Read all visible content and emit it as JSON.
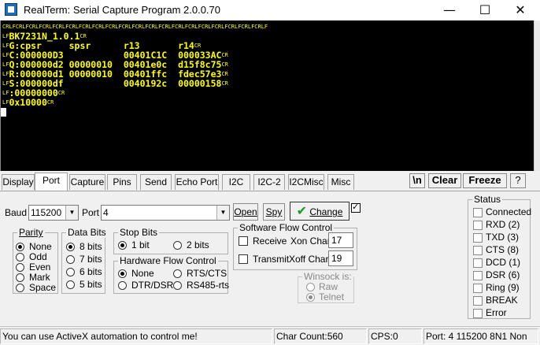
{
  "window": {
    "title": "RealTerm: Serial Capture Program 2.0.0.70",
    "minimize": "—",
    "maximize": "☐",
    "close": "✕"
  },
  "terminal": {
    "lines": [
      {
        "ctl": "LF",
        "text": "",
        "repeat_ctl": true
      },
      {
        "ctl": "LF",
        "text": "BK7231N_1.0.1",
        "tail": "CR"
      },
      {
        "ctl": "LF",
        "text": "G:cpsr     spsr      r13       r14",
        "tail": "CR"
      },
      {
        "ctl": "LF",
        "text": "C:000000D3           00401C1C  000033AC",
        "tail": "CR"
      },
      {
        "ctl": "LF",
        "text": "Q:000000d2 00000010  00401e0c  d15f8c75",
        "tail": "CR"
      },
      {
        "ctl": "LF",
        "text": "R:000000d1 00000010  00401ffc  fdec57e3",
        "tail": "CR"
      },
      {
        "ctl": "LF",
        "text": "S:000000df           0040192c  00000158",
        "tail": "CR"
      },
      {
        "ctl": "LF",
        "text": ":00000000",
        "tail": "CR"
      },
      {
        "ctl": "LF",
        "text": "0x10000",
        "tail": "CR"
      }
    ]
  },
  "tabs": [
    "Display",
    "Port",
    "Capture",
    "Pins",
    "Send",
    "Echo Port",
    "I2C",
    "I2C-2",
    "I2CMisc",
    "Misc"
  ],
  "active_tab": "Port",
  "top_buttons": {
    "newline": "\\n",
    "clear": "Clear",
    "freeze": "Freeze",
    "help": "?"
  },
  "port": {
    "baud_label": "Baud",
    "baud_value": "115200",
    "port_label": "Port",
    "port_value": "4",
    "open_label": "Open",
    "spy_label": "Spy",
    "change_label": "Change"
  },
  "parity": {
    "title": "Parity",
    "options": [
      "None",
      "Odd",
      "Even",
      "Mark",
      "Space"
    ],
    "selected": "None"
  },
  "data_bits": {
    "title": "Data Bits",
    "options": [
      "8 bits",
      "7 bits",
      "6 bits",
      "5 bits"
    ],
    "selected": "8 bits"
  },
  "stop_bits": {
    "title": "Stop Bits",
    "options": [
      "1 bit",
      "2 bits"
    ],
    "selected": "1 bit"
  },
  "hw_flow": {
    "title": "Hardware Flow Control",
    "options": [
      "None",
      "RTS/CTS",
      "DTR/DSR",
      "RS485-rts"
    ],
    "selected": "None"
  },
  "sw_flow": {
    "title": "Software Flow Control",
    "receive_label": "Receive",
    "transmit_label": "Transmit",
    "xon_label": "Xon Char:",
    "xon_value": "17",
    "xoff_label": "Xoff Char:",
    "xoff_value": "19"
  },
  "winsock": {
    "title": "Winsock is:",
    "options": [
      "Raw",
      "Telnet"
    ],
    "selected": "Telnet"
  },
  "status": {
    "title": "Status",
    "items": [
      "Connected",
      "RXD (2)",
      "TXD (3)",
      "CTS (8)",
      "DCD (1)",
      "DSR (6)",
      "Ring (9)",
      "BREAK",
      "Error"
    ]
  },
  "statusbar": {
    "message": "You can use ActiveX automation to control me!",
    "char_count": "Char Count:560",
    "cps": "CPS:0",
    "port_info": "Port: 4 115200 8N1 Non"
  }
}
